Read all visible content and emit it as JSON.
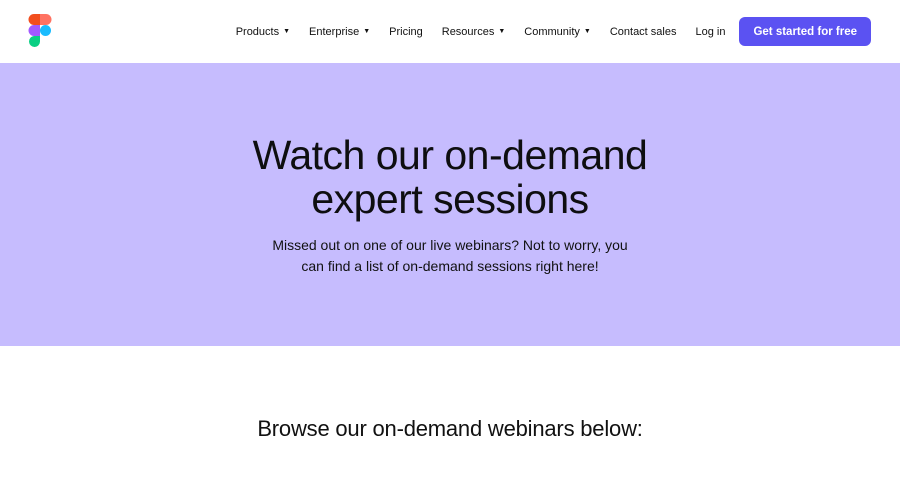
{
  "nav": {
    "items": [
      {
        "label": "Products",
        "dropdown": true
      },
      {
        "label": "Enterprise",
        "dropdown": true
      },
      {
        "label": "Pricing",
        "dropdown": false
      },
      {
        "label": "Resources",
        "dropdown": true
      },
      {
        "label": "Community",
        "dropdown": true
      },
      {
        "label": "Contact sales",
        "dropdown": false
      },
      {
        "label": "Log in",
        "dropdown": false
      }
    ],
    "caret": "▼",
    "cta_label": "Get started for free"
  },
  "hero": {
    "title_line1": "Watch our on-demand",
    "title_line2": "expert sessions",
    "subtitle_line1": "Missed out on one of our live webinars? Not to worry, you",
    "subtitle_line2": "can find a list of on-demand sessions right here!"
  },
  "browse": {
    "heading": "Browse our on-demand webinars below:"
  },
  "colors": {
    "hero_background": "#c6bcfe",
    "cta_background": "#5b52f2",
    "logo_red": "#f24e1e",
    "logo_orange": "#ff7262",
    "logo_purple": "#a259ff",
    "logo_blue": "#1abcfe",
    "logo_green": "#0acf83"
  },
  "icons": {
    "logo": "figma-logo-icon",
    "caret": "caret-down-icon"
  }
}
